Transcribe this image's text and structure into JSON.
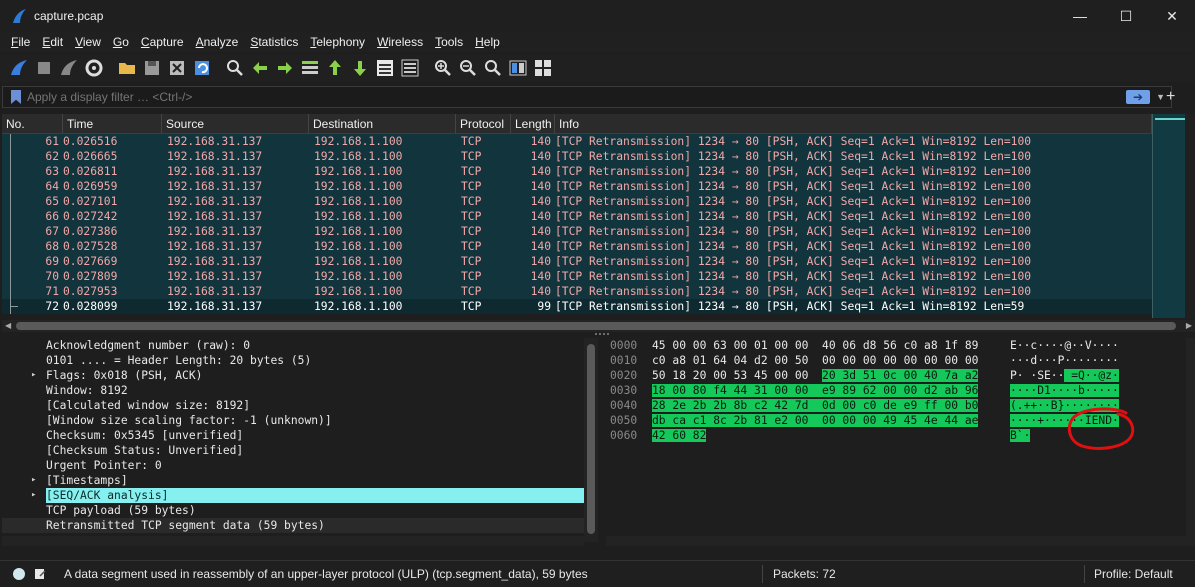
{
  "window": {
    "title": "capture.pcap",
    "minimize": "—",
    "maximize": "☐",
    "close": "✕"
  },
  "menu": [
    "File",
    "Edit",
    "View",
    "Go",
    "Capture",
    "Analyze",
    "Statistics",
    "Telephony",
    "Wireless",
    "Tools",
    "Help"
  ],
  "toolbar_icons": [
    "shark-fin-start-icon",
    "stop-square-icon",
    "restart-fin-icon",
    "gear-options-icon",
    "open-folder-icon",
    "save-file-icon",
    "close-file-icon",
    "reload-icon",
    "find-magnifier-icon",
    "back-arrow-icon",
    "forward-arrow-icon",
    "goto-packet-icon",
    "first-packet-icon",
    "last-packet-icon",
    "autoscroll-icon",
    "colorize-icon",
    "zoom-in-icon",
    "zoom-out-icon",
    "zoom-normal-icon",
    "resize-columns-icon",
    "expand-icon"
  ],
  "filter": {
    "placeholder": "Apply a display filter … <Ctrl-/>",
    "plus": "+"
  },
  "columns": {
    "no": "No.",
    "time": "Time",
    "source": "Source",
    "destination": "Destination",
    "protocol": "Protocol",
    "length": "Length",
    "info": "Info"
  },
  "packets": [
    {
      "no": "61",
      "time": "0.026516",
      "src": "192.168.31.137",
      "dst": "192.168.1.100",
      "proto": "TCP",
      "len": "140",
      "info": "[TCP Retransmission] 1234 → 80 [PSH, ACK] Seq=1 Ack=1 Win=8192 Len=100"
    },
    {
      "no": "62",
      "time": "0.026665",
      "src": "192.168.31.137",
      "dst": "192.168.1.100",
      "proto": "TCP",
      "len": "140",
      "info": "[TCP Retransmission] 1234 → 80 [PSH, ACK] Seq=1 Ack=1 Win=8192 Len=100"
    },
    {
      "no": "63",
      "time": "0.026811",
      "src": "192.168.31.137",
      "dst": "192.168.1.100",
      "proto": "TCP",
      "len": "140",
      "info": "[TCP Retransmission] 1234 → 80 [PSH, ACK] Seq=1 Ack=1 Win=8192 Len=100"
    },
    {
      "no": "64",
      "time": "0.026959",
      "src": "192.168.31.137",
      "dst": "192.168.1.100",
      "proto": "TCP",
      "len": "140",
      "info": "[TCP Retransmission] 1234 → 80 [PSH, ACK] Seq=1 Ack=1 Win=8192 Len=100"
    },
    {
      "no": "65",
      "time": "0.027101",
      "src": "192.168.31.137",
      "dst": "192.168.1.100",
      "proto": "TCP",
      "len": "140",
      "info": "[TCP Retransmission] 1234 → 80 [PSH, ACK] Seq=1 Ack=1 Win=8192 Len=100"
    },
    {
      "no": "66",
      "time": "0.027242",
      "src": "192.168.31.137",
      "dst": "192.168.1.100",
      "proto": "TCP",
      "len": "140",
      "info": "[TCP Retransmission] 1234 → 80 [PSH, ACK] Seq=1 Ack=1 Win=8192 Len=100"
    },
    {
      "no": "67",
      "time": "0.027386",
      "src": "192.168.31.137",
      "dst": "192.168.1.100",
      "proto": "TCP",
      "len": "140",
      "info": "[TCP Retransmission] 1234 → 80 [PSH, ACK] Seq=1 Ack=1 Win=8192 Len=100"
    },
    {
      "no": "68",
      "time": "0.027528",
      "src": "192.168.31.137",
      "dst": "192.168.1.100",
      "proto": "TCP",
      "len": "140",
      "info": "[TCP Retransmission] 1234 → 80 [PSH, ACK] Seq=1 Ack=1 Win=8192 Len=100"
    },
    {
      "no": "69",
      "time": "0.027669",
      "src": "192.168.31.137",
      "dst": "192.168.1.100",
      "proto": "TCP",
      "len": "140",
      "info": "[TCP Retransmission] 1234 → 80 [PSH, ACK] Seq=1 Ack=1 Win=8192 Len=100"
    },
    {
      "no": "70",
      "time": "0.027809",
      "src": "192.168.31.137",
      "dst": "192.168.1.100",
      "proto": "TCP",
      "len": "140",
      "info": "[TCP Retransmission] 1234 → 80 [PSH, ACK] Seq=1 Ack=1 Win=8192 Len=100"
    },
    {
      "no": "71",
      "time": "0.027953",
      "src": "192.168.31.137",
      "dst": "192.168.1.100",
      "proto": "TCP",
      "len": "140",
      "info": "[TCP Retransmission] 1234 → 80 [PSH, ACK] Seq=1 Ack=1 Win=8192 Len=100"
    },
    {
      "no": "72",
      "time": "0.028099",
      "src": "192.168.31.137",
      "dst": "192.168.1.100",
      "proto": "TCP",
      "len": "99",
      "info": "[TCP Retransmission] 1234 → 80 [PSH, ACK] Seq=1 Ack=1 Win=8192 Len=59",
      "selected": true
    }
  ],
  "details": [
    {
      "text": "Acknowledgment number (raw): 0"
    },
    {
      "text": "0101 .... = Header Length: 20 bytes (5)"
    },
    {
      "text": "Flags: 0x018 (PSH, ACK)",
      "twisty": "▸"
    },
    {
      "text": "Window: 8192"
    },
    {
      "text": "[Calculated window size: 8192]"
    },
    {
      "text": "[Window size scaling factor: -1 (unknown)]"
    },
    {
      "text": "Checksum: 0x5345 [unverified]"
    },
    {
      "text": "[Checksum Status: Unverified]"
    },
    {
      "text": "Urgent Pointer: 0"
    },
    {
      "text": "[Timestamps]",
      "twisty": "▸"
    },
    {
      "text": "[SEQ/ACK analysis]",
      "twisty": "▸",
      "highlight": true
    },
    {
      "text": "TCP payload (59 bytes)"
    },
    {
      "text": "Retransmitted TCP segment data (59 bytes)",
      "gray": true
    }
  ],
  "hex": [
    {
      "off": "0000",
      "bytes": [
        [
          "45 00 00 63 00 01 00 00  40 06 d8 56 c0 a8 1f 89",
          ""
        ]
      ],
      "ascii": [
        [
          "E··c····@··V····",
          ""
        ]
      ]
    },
    {
      "off": "0010",
      "bytes": [
        [
          "c0 a8 01 64 04 d2 00 50  00 00 00 00 00 00 00 00",
          ""
        ]
      ],
      "ascii": [
        [
          "···d···P········",
          ""
        ]
      ]
    },
    {
      "off": "0020",
      "bytes": [
        [
          "50 18 20 00 53 45 00 00  ",
          ""
        ],
        [
          "20 3d 51 0c 00 40 7a a2",
          "g"
        ]
      ],
      "ascii": [
        [
          "P· ·SE··",
          ""
        ],
        [
          " =Q··@z·",
          "g"
        ]
      ]
    },
    {
      "off": "0030",
      "bytes": [
        [
          "18 00 80 f4 44 31 00 00  e9 89 62 00 00 d2 ab 96",
          "g"
        ]
      ],
      "ascii": [
        [
          "····D1····b·····",
          "g"
        ]
      ]
    },
    {
      "off": "0040",
      "bytes": [
        [
          "28 2e 2b 2b 8b c2 42 7d  0d 00 c0 de e9 ff 00 b0",
          "g"
        ]
      ],
      "ascii": [
        [
          "(.++··B}········",
          "g"
        ]
      ]
    },
    {
      "off": "0050",
      "bytes": [
        [
          "db ca c1 8c 2b 81 e2 00  00 00 00 49 45 4e 44 ae",
          "g"
        ]
      ],
      "ascii": [
        [
          "····+······IEND·",
          "g"
        ]
      ]
    },
    {
      "off": "0060",
      "bytes": [
        [
          "42 60 82",
          "g"
        ]
      ],
      "ascii": [
        [
          "B`·",
          "g"
        ]
      ]
    }
  ],
  "status": {
    "message": "A data segment used in reassembly of an upper-layer protocol (ULP) (tcp.segment_data), 59 bytes",
    "packets": "Packets: 72",
    "profile": "Profile: Default"
  },
  "colors": {
    "row_bg": "#12343d",
    "row_fg": "#f2a8a8",
    "hex_highlight": "#14c85a",
    "tree_highlight": "#86f0f0",
    "annotation": "#e01010"
  }
}
